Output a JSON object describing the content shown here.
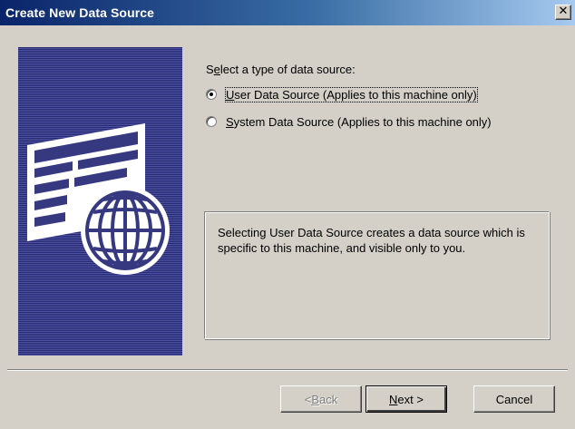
{
  "window": {
    "title": "Create New Data Source",
    "close_glyph": "✕"
  },
  "prompt": {
    "prefix": "S",
    "access_key": "e",
    "rest": "lect a type of data source:"
  },
  "options": [
    {
      "access_key": "U",
      "rest": "ser Data Source (Applies to this machine only)",
      "selected": true
    },
    {
      "access_key": "S",
      "rest": "ystem Data Source (Applies to this machine only)",
      "selected": false
    }
  ],
  "description": "Selecting User Data Source creates a data source which is specific to this machine, and visible only to you.",
  "buttons": {
    "back": {
      "prefix": "< ",
      "access_key": "B",
      "rest": "ack",
      "enabled": false
    },
    "next": {
      "access_key": "N",
      "rest": "ext >"
    },
    "cancel": {
      "label": "Cancel"
    }
  },
  "icons": [
    "data-sheet-icon",
    "globe-icon",
    "close-icon",
    "radio-selected-icon",
    "radio-unselected-icon"
  ],
  "colors": {
    "title_start": "#0a246a",
    "title_end": "#a6caf0",
    "dialog_bg": "#d4d0c8",
    "side_panel": "#363880"
  }
}
